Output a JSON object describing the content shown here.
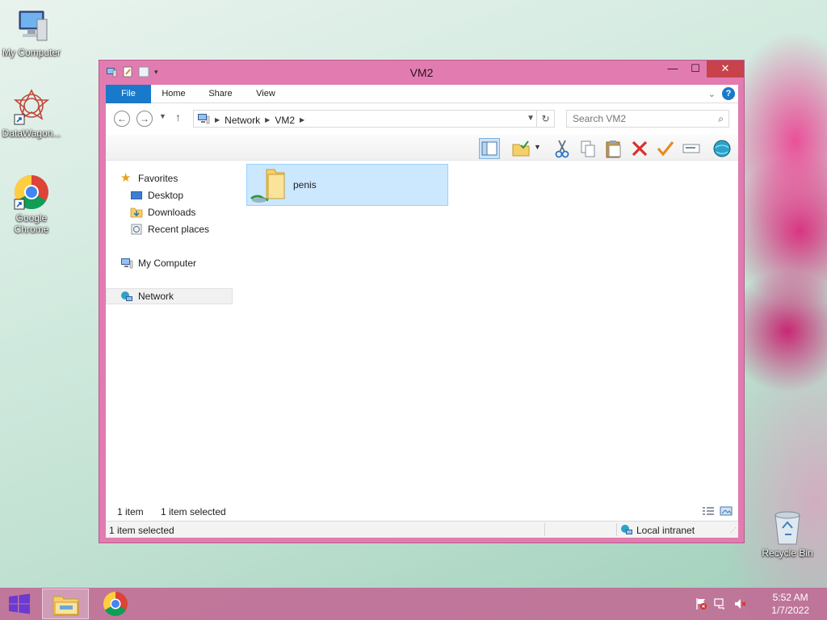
{
  "desktop": {
    "icons": [
      {
        "label": "My Computer",
        "icon": "computer-icon"
      },
      {
        "label": "DataWagon...",
        "icon": "datawagon-icon"
      },
      {
        "label": "Google Chrome",
        "icon": "chrome-icon"
      },
      {
        "label": "Recycle Bin",
        "icon": "recycle-bin-icon"
      }
    ]
  },
  "window": {
    "title": "VM2",
    "controls": {
      "minimize": "—",
      "maximize": "☐",
      "close": "✕"
    },
    "ribbon": {
      "tabs": [
        {
          "label": "File"
        },
        {
          "label": "Home"
        },
        {
          "label": "Share"
        },
        {
          "label": "View"
        }
      ],
      "help": "?"
    },
    "address": {
      "crumbs": [
        "Network",
        "VM2"
      ]
    },
    "search": {
      "placeholder": "Search VM2",
      "value": ""
    },
    "nav_pane": {
      "favorites": "Favorites",
      "favorites_items": [
        "Desktop",
        "Downloads",
        "Recent places"
      ],
      "my_computer": "My Computer",
      "network": "Network"
    },
    "content": {
      "items": [
        {
          "name": "penis",
          "type": "shared-folder",
          "selected": true
        }
      ]
    },
    "status": {
      "count": "1 item",
      "selection": "1 item selected",
      "bar_left": "1 item selected",
      "zone": "Local intranet"
    }
  },
  "taskbar": {
    "clock_time": "5:52 AM",
    "clock_date": "1/7/2022"
  },
  "colors": {
    "window_frame": "#e27cb0",
    "file_tab": "#1979ca",
    "selection": "#cce8ff",
    "close_button": "#c7424a"
  }
}
